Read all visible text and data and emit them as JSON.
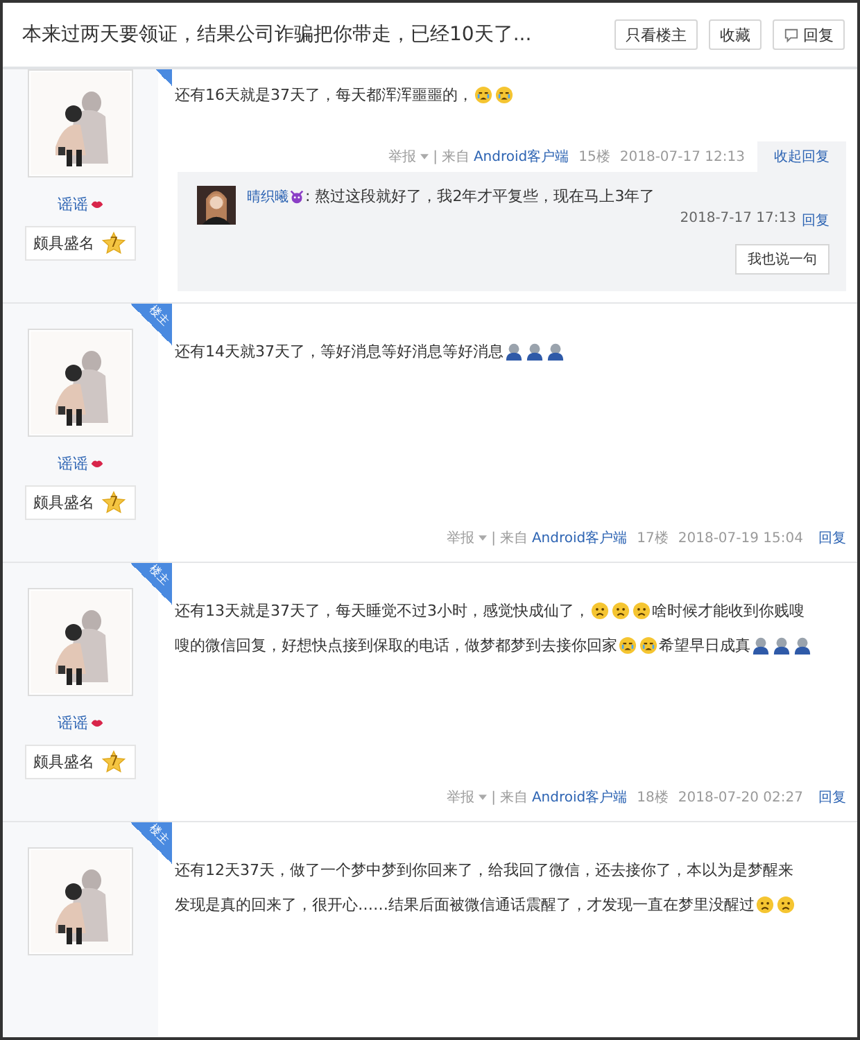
{
  "header": {
    "title": "本来过两天要领证，结果公司诈骗把你带走，已经10天了...",
    "buttons": [
      {
        "label": "只看楼主",
        "kind": "plain"
      },
      {
        "label": "收藏",
        "kind": "plain"
      },
      {
        "label": "回复",
        "kind": "reply"
      }
    ]
  },
  "posts": [
    {
      "author": "谣谣",
      "level_title": "颇具盛名",
      "level": "7",
      "owner": true,
      "content": [
        [
          {
            "kind": "text",
            "text": "还有16天就是37天了，每天都浑浑噩噩的，"
          },
          {
            "kind": "cry"
          },
          {
            "kind": "cry"
          }
        ]
      ],
      "report": "举报",
      "divider": "|",
      "source_prefix": "来自",
      "source": "Android客户端",
      "floor": "15楼",
      "time": "2018-07-17 12:13",
      "reply_action": "收起回复",
      "expanded": true,
      "replies": [
        {
          "author": "晴织曦",
          "text": ": 熬过这段就好了，我2年才平复些，现在马上3年了",
          "time": "2018-7-17 17:13",
          "action": "回复"
        }
      ],
      "say_button": "我也说一句"
    },
    {
      "author": "谣谣",
      "level_title": "颇具盛名",
      "level": "7",
      "owner": true,
      "badge": "楼主",
      "content": [
        [
          {
            "kind": "text",
            "text": "还有14天就37天了，等好消息等好消息等好消息"
          },
          {
            "kind": "pray"
          },
          {
            "kind": "pray"
          },
          {
            "kind": "pray"
          }
        ]
      ],
      "report": "举报",
      "divider": "|",
      "source_prefix": "来自",
      "source": "Android客户端",
      "floor": "17楼",
      "time": "2018-07-19 15:04",
      "reply_action": "回复",
      "expanded": false
    },
    {
      "author": "谣谣",
      "level_title": "颇具盛名",
      "level": "7",
      "owner": true,
      "badge": "楼主",
      "content": [
        [
          {
            "kind": "text",
            "text": "还有13天就是37天了，每天睡觉不过3小时，感觉快成仙了，"
          },
          {
            "kind": "sad"
          },
          {
            "kind": "sad"
          },
          {
            "kind": "sad"
          },
          {
            "kind": "text",
            "text": "啥时候才能收到你贱嗖"
          }
        ],
        [
          {
            "kind": "text",
            "text": "嗖的微信回复，好想快点接到保取的电话，做梦都梦到去接你回家"
          },
          {
            "kind": "cry"
          },
          {
            "kind": "cry"
          },
          {
            "kind": "text",
            "text": "希望早日成真"
          },
          {
            "kind": "pray"
          },
          {
            "kind": "pray"
          },
          {
            "kind": "pray"
          }
        ]
      ],
      "report": "举报",
      "divider": "|",
      "source_prefix": "来自",
      "source": "Android客户端",
      "floor": "18楼",
      "time": "2018-07-20 02:27",
      "reply_action": "回复",
      "expanded": false
    },
    {
      "owner": true,
      "badge": "楼主",
      "content": [
        [
          {
            "kind": "text",
            "text": "还有12天37天，做了一个梦中梦到你回来了，给我回了微信，还去接你了，本以为是梦醒来"
          }
        ],
        [
          {
            "kind": "text",
            "text": "发现是真的回来了，很开心……结果后面被微信通话震醒了，才发现一直在梦里没醒过"
          },
          {
            "kind": "sad"
          },
          {
            "kind": "sad"
          }
        ]
      ]
    }
  ]
}
